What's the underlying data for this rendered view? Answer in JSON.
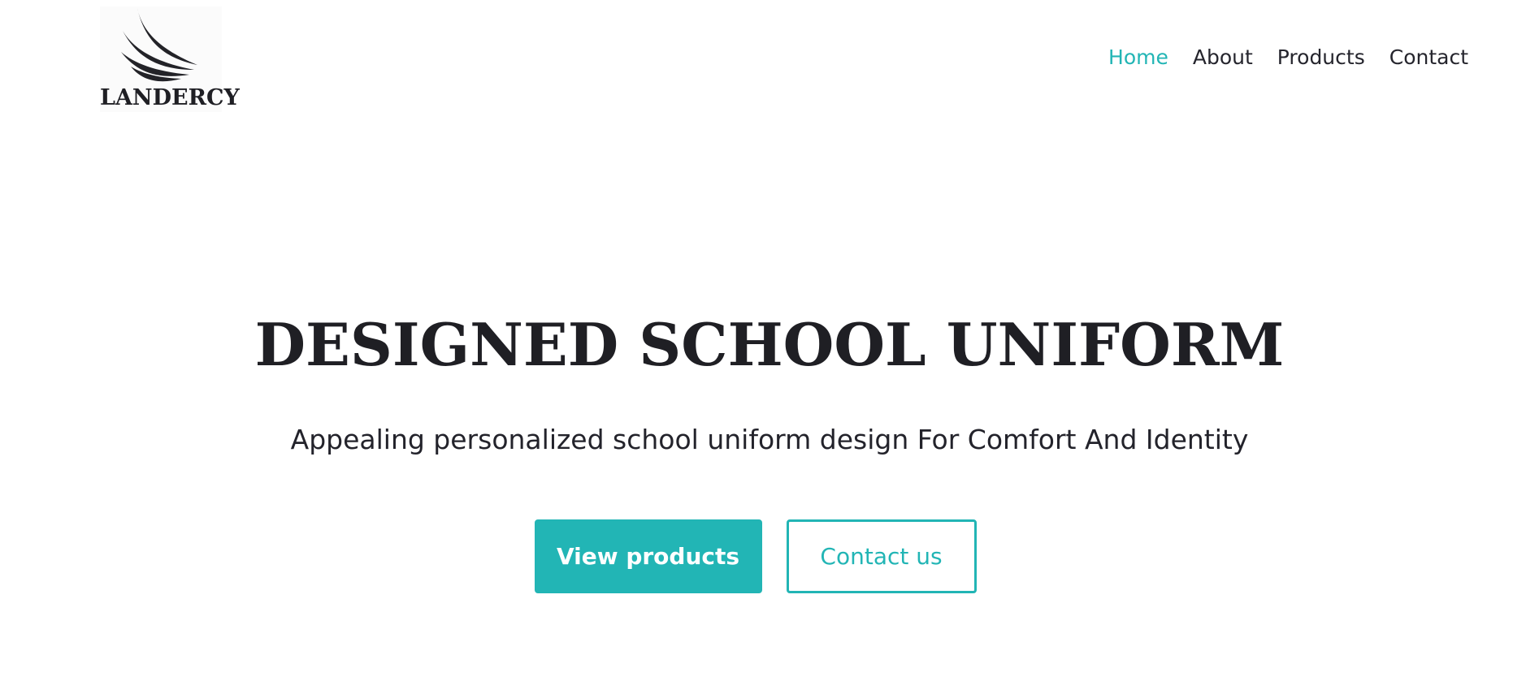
{
  "brand": {
    "name": "LANDERCY"
  },
  "nav": {
    "items": [
      {
        "label": "Home",
        "active": true
      },
      {
        "label": "About",
        "active": false
      },
      {
        "label": "Products",
        "active": false
      },
      {
        "label": "Contact",
        "active": false
      }
    ]
  },
  "hero": {
    "title": "DESIGNED SCHOOL UNIFORM",
    "subtitle": "Appealing personalized school uniform design For Comfort And Identity",
    "primary_button": "View products",
    "secondary_button": "Contact us"
  },
  "colors": {
    "accent": "#22b5b5",
    "text": "#23232b",
    "background": "#ffffff"
  },
  "icons": {
    "logo_mark": "wing-icon"
  }
}
